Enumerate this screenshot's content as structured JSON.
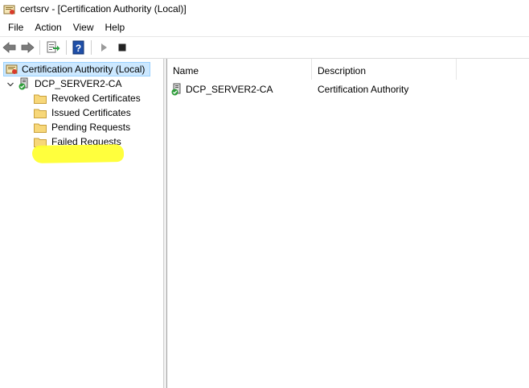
{
  "window": {
    "title": "certsrv - [Certification Authority (Local)]",
    "app_icon": "certsrv-icon"
  },
  "menu": {
    "items": [
      "File",
      "Action",
      "View",
      "Help"
    ]
  },
  "toolbar": {
    "buttons": [
      "back-icon",
      "forward-icon",
      "export-list-icon",
      "help-icon",
      "start-service-icon",
      "stop-service-icon"
    ]
  },
  "tree": {
    "root_label": "Certification Authority (Local)",
    "ca_label": "DCP_SERVER2-CA",
    "children": [
      {
        "label": "Revoked Certificates"
      },
      {
        "label": "Issued Certificates"
      },
      {
        "label": "Pending Requests"
      },
      {
        "label": "Failed Requests"
      }
    ]
  },
  "list": {
    "columns": [
      "Name",
      "Description"
    ],
    "rows": [
      {
        "name": "DCP_SERVER2-CA",
        "description": "Certification Authority"
      }
    ]
  },
  "colors": {
    "selection_bg": "#cce8ff",
    "selection_border": "#99d1ff",
    "annotation_highlight": "#ffff33",
    "help_icon_blue": "#1f4fa8"
  }
}
